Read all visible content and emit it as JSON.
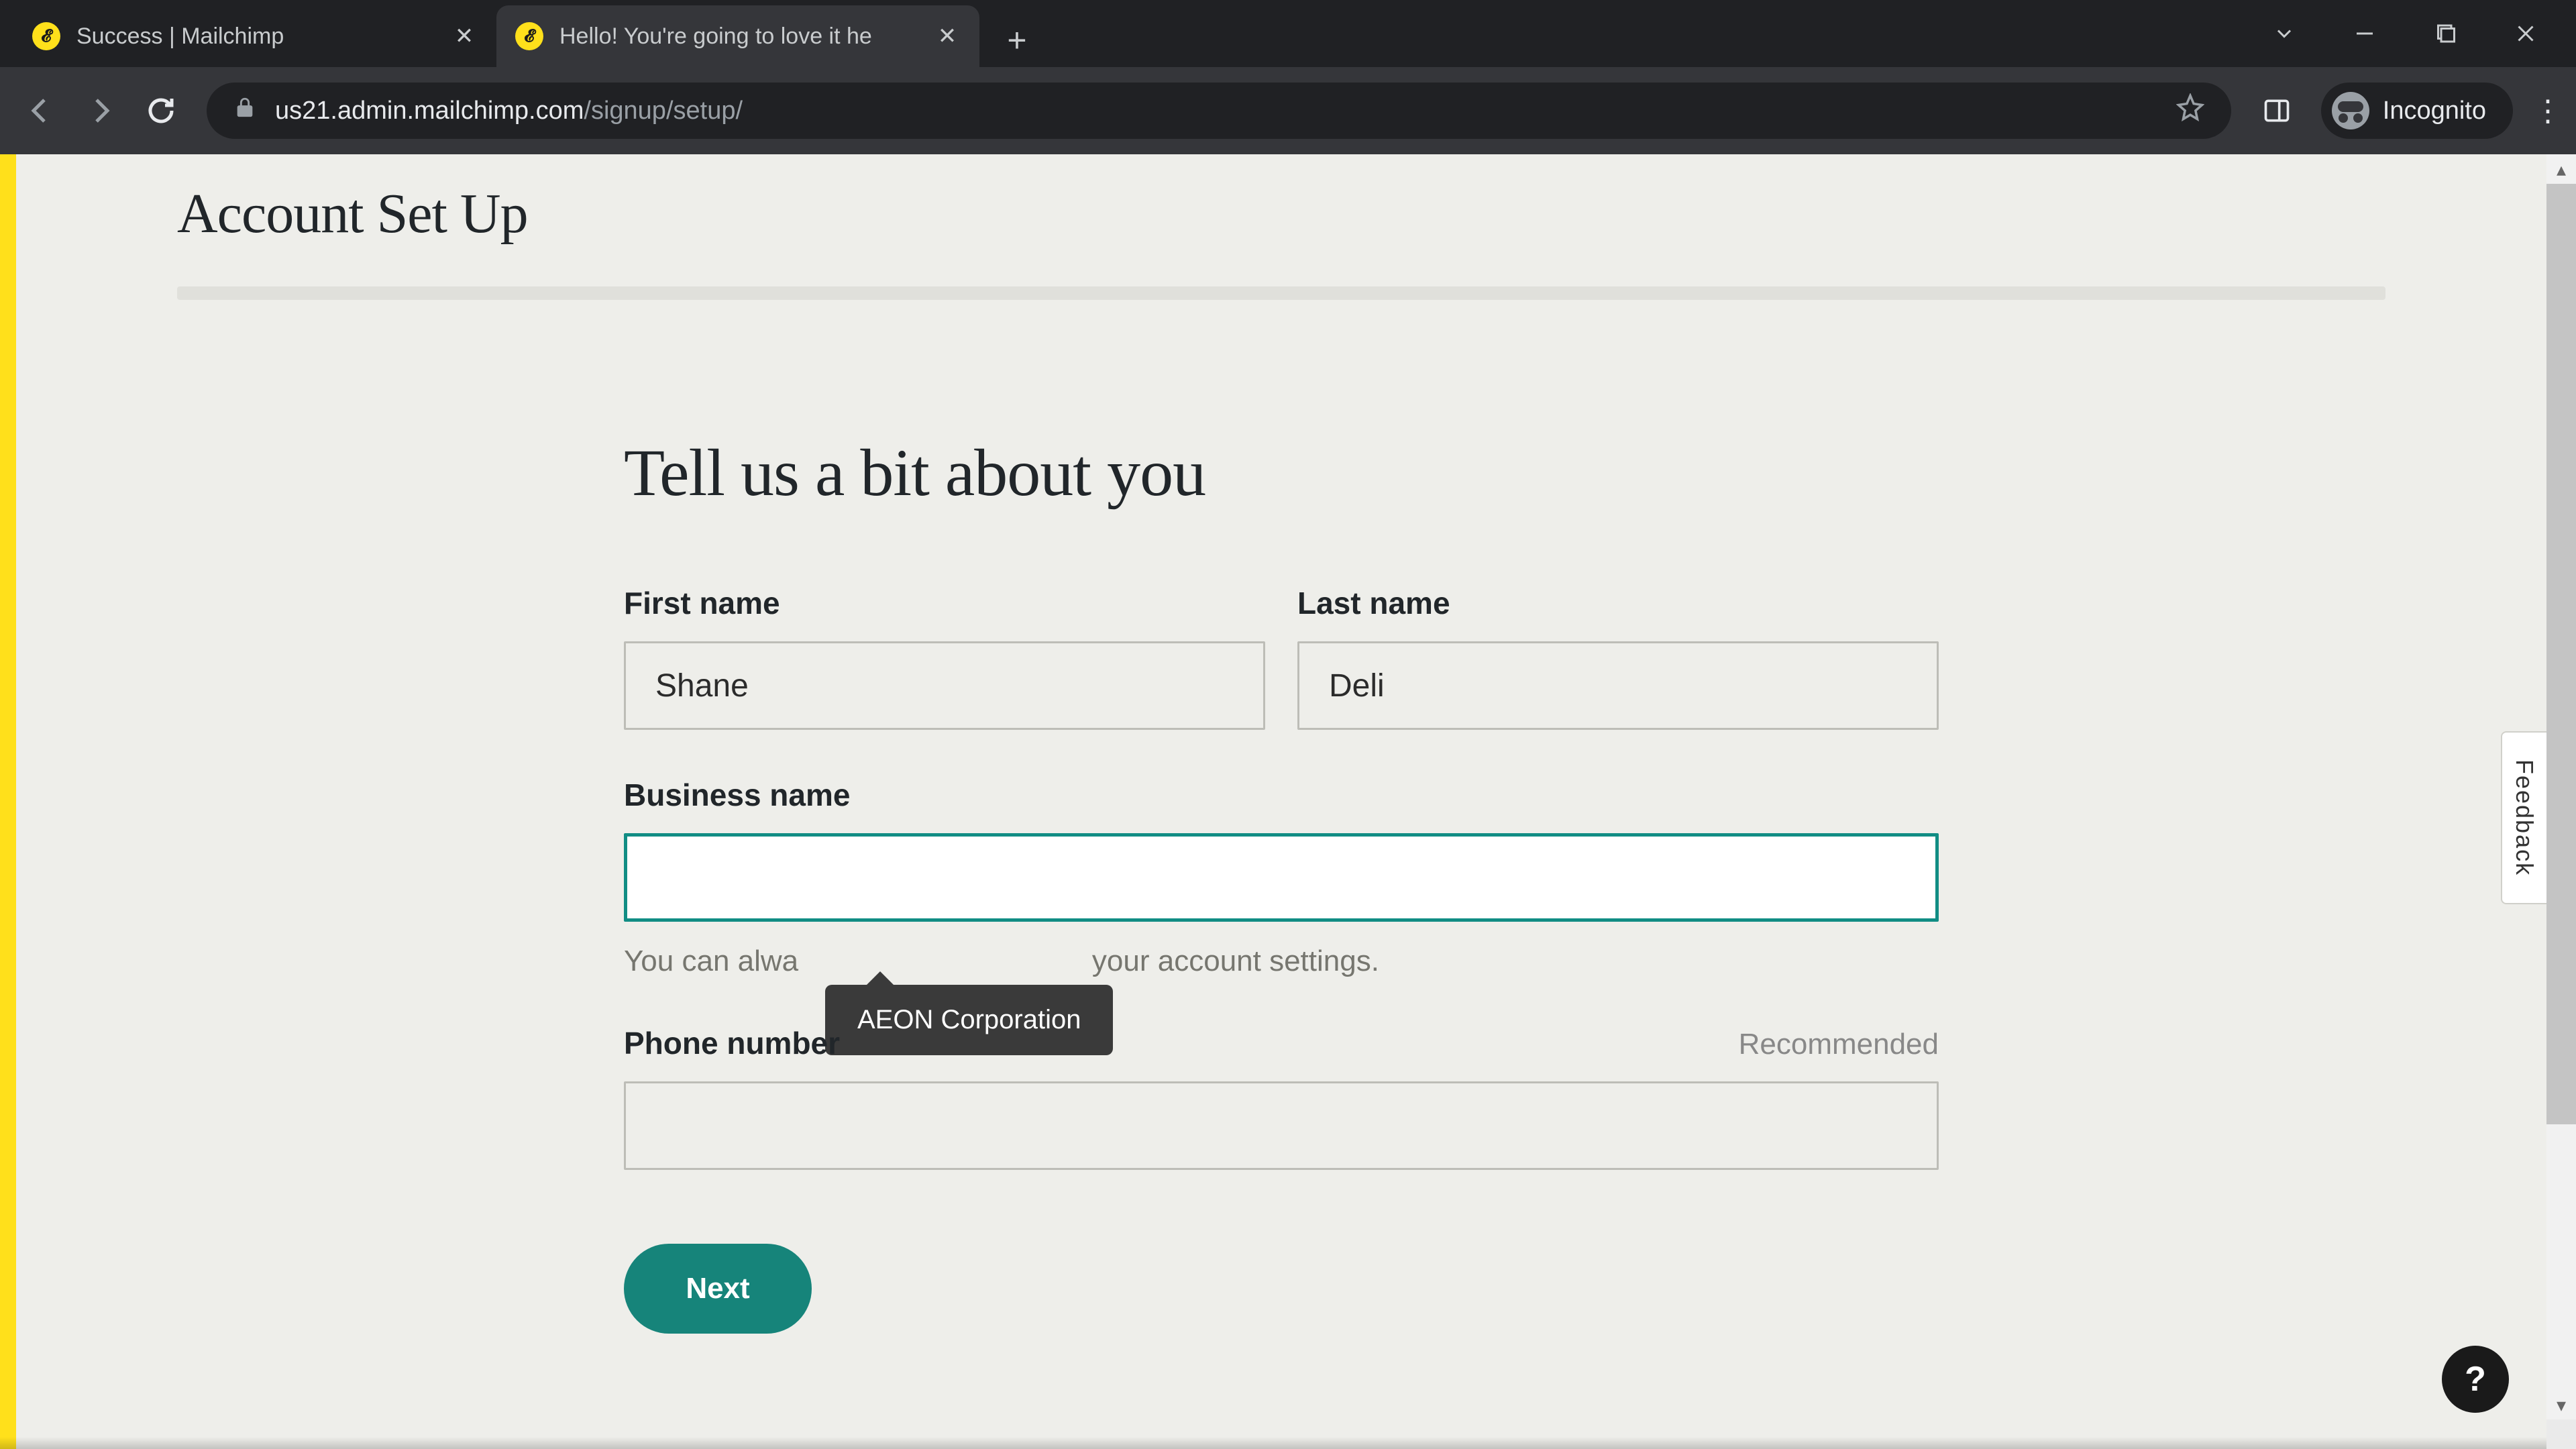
{
  "browser": {
    "tabs": [
      {
        "title": "Success | Mailchimp",
        "active": false
      },
      {
        "title": "Hello! You're going to love it he",
        "active": true
      }
    ],
    "url_host": "us21.admin.mailchimp.com",
    "url_path": "/signup/setup/",
    "incognito_label": "Incognito"
  },
  "page": {
    "title": "Account Set Up",
    "heading": "Tell us a bit about you",
    "labels": {
      "first_name": "First name",
      "last_name": "Last name",
      "business_name": "Business name",
      "phone": "Phone number",
      "recommended": "Recommended"
    },
    "values": {
      "first_name": "Shane",
      "last_name": "Deli",
      "business_name": "",
      "phone": ""
    },
    "helper": {
      "business_visible_prefix": "You can alwa",
      "business_visible_suffix": " your account settings."
    },
    "autofill_suggestion": "AEON Corporation",
    "next_button": "Next",
    "feedback_label": "Feedback",
    "help_label": "?"
  }
}
